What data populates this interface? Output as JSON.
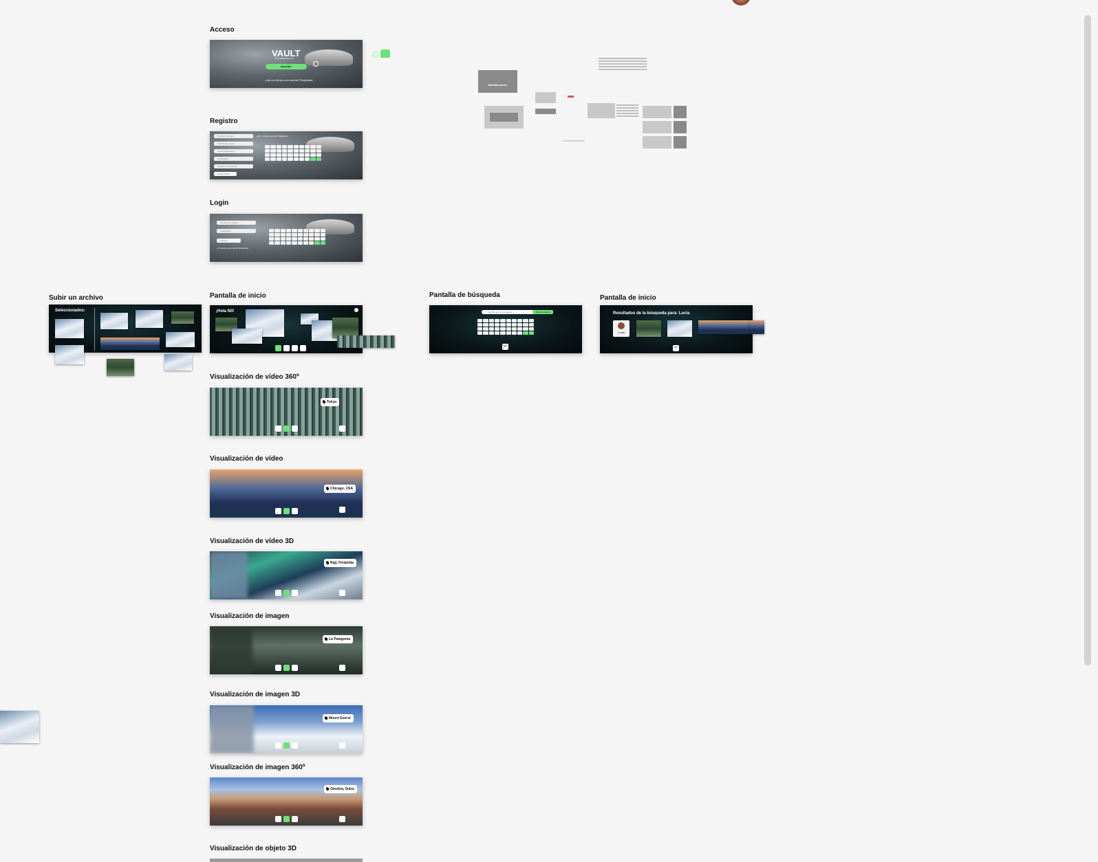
{
  "sections": {
    "acceso": "Acceso",
    "registro": "Registro",
    "login": "Login",
    "subir": "Subir un archivo",
    "inicio1": "Pantalla de inicio",
    "busqueda": "Pantalla de búsqueda",
    "inicio2": "Pantalla de inicio",
    "v360": "Visualización  de vídeo 360º",
    "video": "Visualización  de vídeo",
    "video3d": "Visualización  de vídeo 3D",
    "imagen": "Visualización  de imagen",
    "imagen3d": "Visualización  de imagen  3D",
    "imagen360": "Visualización  de imagen  360º",
    "objeto3d": "Visualización  de objeto 3D"
  },
  "acceso": {
    "brand": "VAULT",
    "tagline": "Your MultiMemories",
    "button": "Acceder",
    "footer": "¿Aún no tienes una cuenta? Regístrate"
  },
  "registro": {
    "fields": [
      "Nombre completo",
      "Nombre de usuario",
      "Correo electrónico",
      "Contraseña",
      "Repetir la contraseña"
    ],
    "button": "Crear cuenta",
    "hint": "¿Aún no tienes cuenta? Regístrate"
  },
  "login": {
    "fields": [
      "Nombre de usuario",
      "Contraseña"
    ],
    "button": "Acceder",
    "footer": "¿Ya tienes una cuenta? Regístrate"
  },
  "subir": {
    "selected": "Seleccionados:"
  },
  "inicio1": {
    "greeting": "¡Hola Nil!"
  },
  "busqueda": {
    "placeholder": "Escribe aquí una etiqueta",
    "button": "Buscar etiqueta"
  },
  "inicio2": {
    "results": "Resultados de la búsqueda para: Lucia",
    "person": "Lucia"
  },
  "locations": {
    "v360": "Tokyo",
    "video": "Chicago, USA",
    "video3d": "Rajj, Finlandia",
    "imagen": "La Patagonia",
    "imagen3d": "Mount Everst",
    "imagen360": "Ginebra, Suiza"
  },
  "wireframe": {
    "title": "MultiMemories"
  },
  "colors": {
    "accent": "#6ee07a",
    "canvas": "#f5f5f5"
  }
}
